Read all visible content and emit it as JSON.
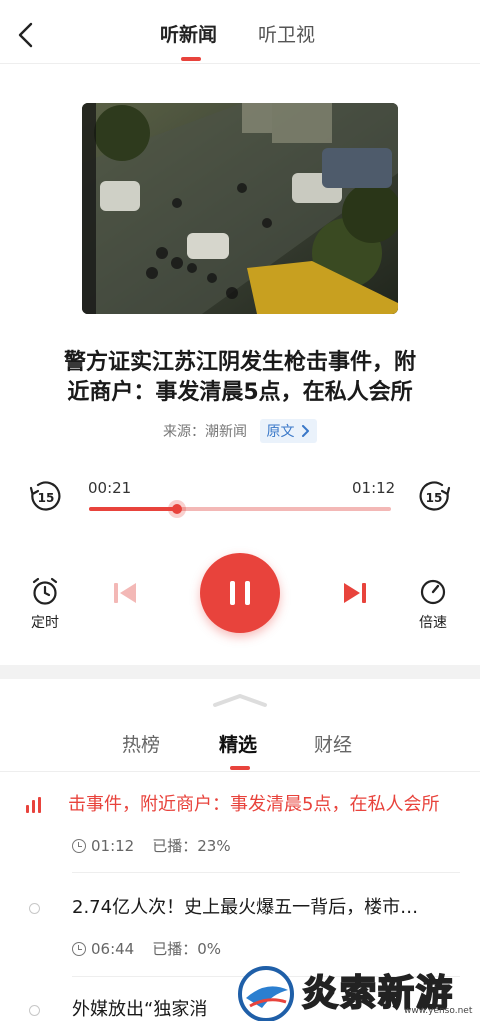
{
  "header": {
    "tabs": [
      {
        "label": "听新闻",
        "active": true
      },
      {
        "label": "听卫视",
        "active": false
      }
    ]
  },
  "article": {
    "title_line1": "警方证实江苏江阴发生枪击事件，附",
    "title_line2": "近商户：事发清晨5点，在私人会所",
    "source": "来源：潮新闻",
    "original_label": "原文"
  },
  "player": {
    "current_time": "00:21",
    "total_time": "01:12",
    "progress": 0.29,
    "rewind_label": "15",
    "forward_label": "15",
    "timer_label": "定时",
    "speed_label": "倍速"
  },
  "sheet": {
    "tabs": [
      {
        "label": "热榜",
        "active": false
      },
      {
        "label": "精选",
        "active": true
      },
      {
        "label": "财经",
        "active": false
      }
    ],
    "items": [
      {
        "title": "击事件，附近商户：事发清晨5点，在私人会所",
        "duration": "01:12",
        "played": "已播：23%",
        "playing": true
      },
      {
        "title": "2.74亿人次！史上最火爆五一背后，楼市…",
        "duration": "06:44",
        "played": "已播：0%",
        "playing": false
      },
      {
        "title": "外媒放出“独家消",
        "duration": "",
        "played": "",
        "playing": false
      }
    ]
  },
  "watermark": {
    "text": "炎索新游网",
    "url": "www.yenso.net"
  },
  "colors": {
    "accent": "#e8433c",
    "link": "#3a78c8"
  }
}
